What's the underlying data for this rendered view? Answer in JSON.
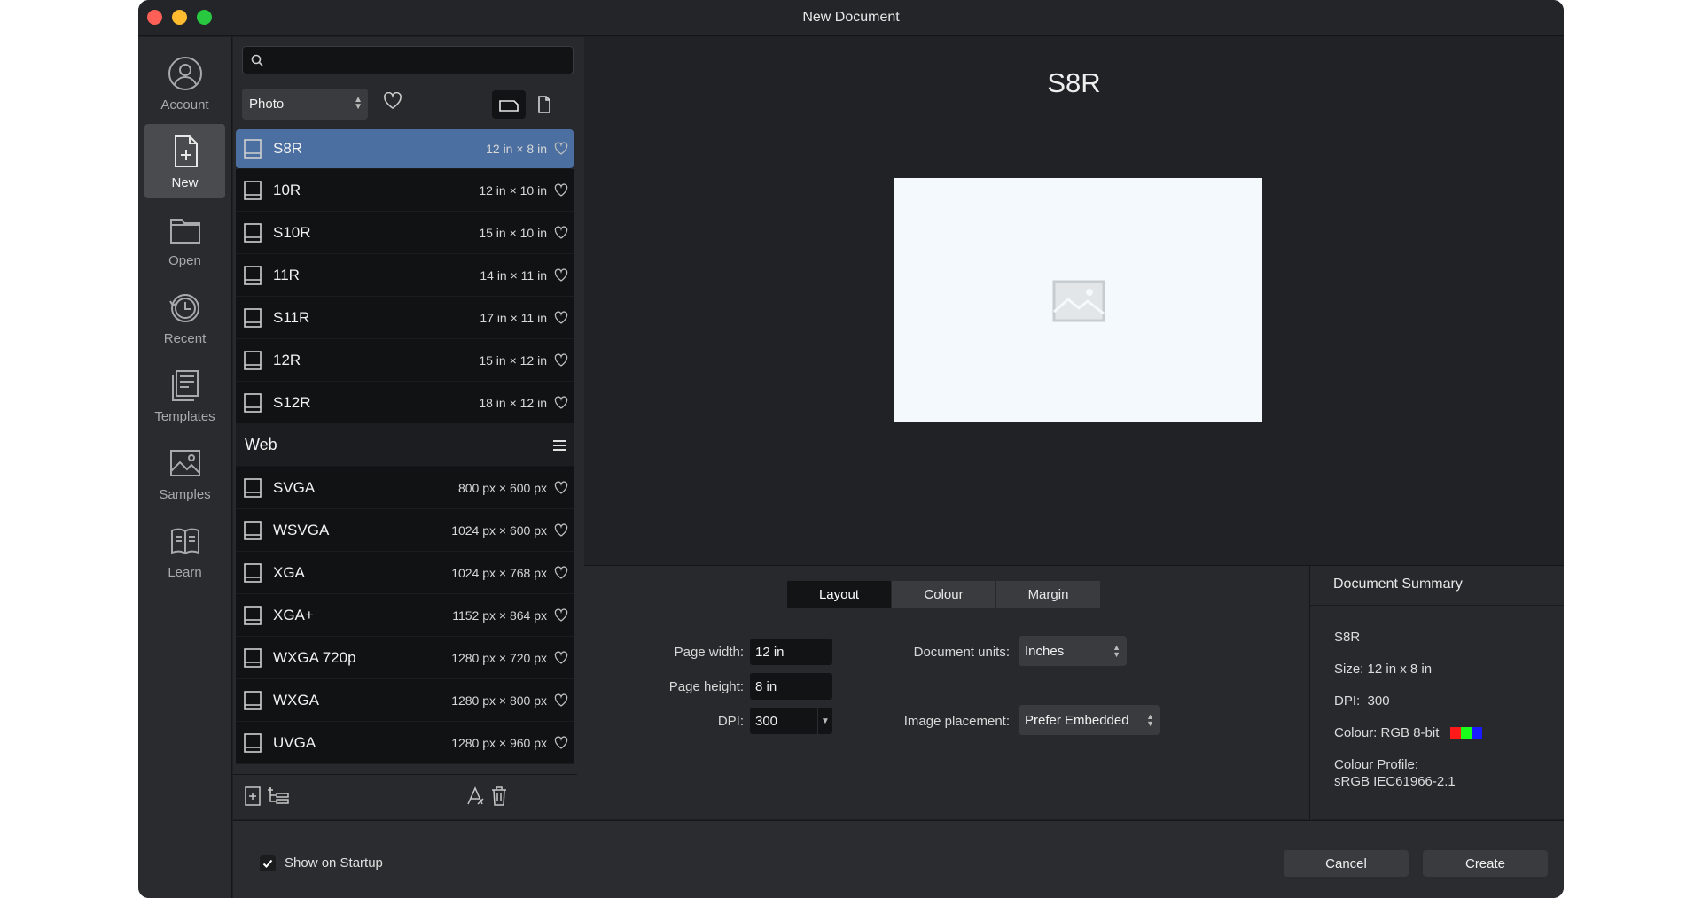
{
  "window": {
    "title": "New Document"
  },
  "sidebar": {
    "items": [
      {
        "label": "Account",
        "icon": "account-icon"
      },
      {
        "label": "New",
        "icon": "new-document-icon",
        "active": true
      },
      {
        "label": "Open",
        "icon": "folder-icon"
      },
      {
        "label": "Recent",
        "icon": "recent-clock-icon"
      },
      {
        "label": "Templates",
        "icon": "templates-icon"
      },
      {
        "label": "Samples",
        "icon": "samples-image-icon"
      },
      {
        "label": "Learn",
        "icon": "learn-book-icon"
      }
    ]
  },
  "presets": {
    "search": {
      "value": "",
      "placeholder": ""
    },
    "category": "Photo",
    "photo_items": [
      {
        "name": "S8R",
        "size": "12 in × 8 in",
        "selected": true
      },
      {
        "name": "10R",
        "size": "12 in × 10 in"
      },
      {
        "name": "S10R",
        "size": "15 in × 10 in"
      },
      {
        "name": "11R",
        "size": "14 in × 11 in"
      },
      {
        "name": "S11R",
        "size": "17 in × 11 in"
      },
      {
        "name": "12R",
        "size": "15 in × 12 in"
      },
      {
        "name": "S12R",
        "size": "18 in × 12 in"
      }
    ],
    "web_group": "Web",
    "web_items": [
      {
        "name": "SVGA",
        "size": "800 px × 600 px"
      },
      {
        "name": "WSVGA",
        "size": "1024 px × 600 px"
      },
      {
        "name": "XGA",
        "size": "1024 px × 768 px"
      },
      {
        "name": "XGA+",
        "size": "1152 px × 864 px"
      },
      {
        "name": "WXGA 720p",
        "size": "1280 px × 720 px"
      },
      {
        "name": "WXGA",
        "size": "1280 px × 800 px"
      },
      {
        "name": "UVGA",
        "size": "1280 px × 960 px"
      }
    ]
  },
  "preview": {
    "title": "S8R"
  },
  "settings": {
    "tabs": [
      "Layout",
      "Colour",
      "Margin"
    ],
    "active_tab": "Layout",
    "page_width_label": "Page width:",
    "page_width": "12 in",
    "page_height_label": "Page height:",
    "page_height": "8 in",
    "dpi_label": "DPI:",
    "dpi": "300",
    "units_label": "Document units:",
    "units": "Inches",
    "placement_label": "Image placement:",
    "placement": "Prefer Embedded"
  },
  "summary": {
    "heading": "Document Summary",
    "name": "S8R",
    "size": "Size: 12 in x 8 in",
    "dpi": "DPI:  300",
    "colour": "Colour: RGB 8-bit",
    "colour_swatches": [
      "#ff1a1a",
      "#1aff1a",
      "#1a1aff"
    ],
    "profile_label": "Colour Profile:",
    "profile": "sRGB IEC61966-2.1"
  },
  "footer": {
    "show_on_startup": "Show on Startup",
    "show_on_startup_checked": true,
    "cancel": "Cancel",
    "create": "Create"
  }
}
